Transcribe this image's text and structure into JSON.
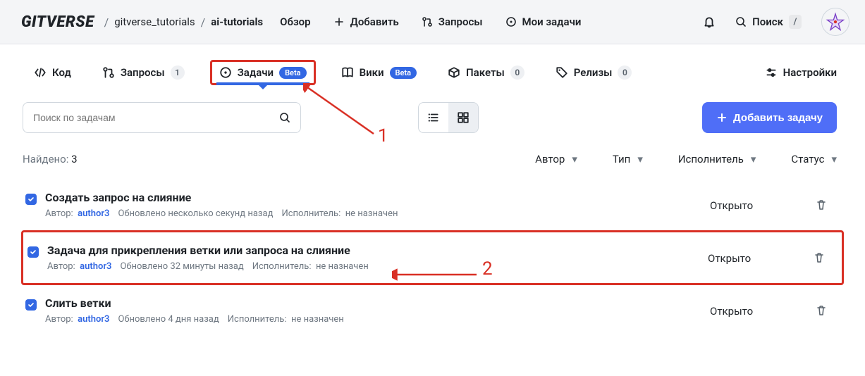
{
  "header": {
    "logo": "GITVERSE",
    "crumb1": "gitverse_tutorials",
    "crumb2": "ai-tutorials",
    "nav": {
      "overview": "Обзор",
      "add": "Добавить",
      "requests": "Запросы",
      "my_tasks": "Мои задачи",
      "search": "Поиск",
      "search_kbd": "/"
    }
  },
  "tabs": {
    "code": "Код",
    "requests": "Запросы",
    "requests_count": "1",
    "tasks": "Задачи",
    "tasks_badge": "Beta",
    "wiki": "Вики",
    "wiki_badge": "Beta",
    "packages": "Пакеты",
    "packages_count": "0",
    "releases": "Релизы",
    "releases_count": "0",
    "settings": "Настройки"
  },
  "toolbar": {
    "search_placeholder": "Поиск по задачам",
    "add_task": "Добавить задачу"
  },
  "filters": {
    "found_label": "Найдено:",
    "found_count": "3",
    "author": "Автор",
    "type": "Тип",
    "assignee": "Исполнитель",
    "status": "Статус"
  },
  "meta_labels": {
    "author": "Автор:",
    "updated": "Обновлено",
    "assignee": "Исполнитель:"
  },
  "tasks": [
    {
      "title": "Создать запрос на слияние",
      "author": "author3",
      "updated": "несколько секунд назад",
      "assignee": "не назначен",
      "status": "Открыто"
    },
    {
      "title": "Задача для прикрепления ветки или запроса на слияние",
      "author": "author3",
      "updated": "32 минуты назад",
      "assignee": "не назначен",
      "status": "Открыто"
    },
    {
      "title": "Слить ветки",
      "author": "author3",
      "updated": "4 дня назад",
      "assignee": "не назначен",
      "status": "Открыто"
    }
  ],
  "annotations": {
    "one": "1",
    "two": "2"
  }
}
